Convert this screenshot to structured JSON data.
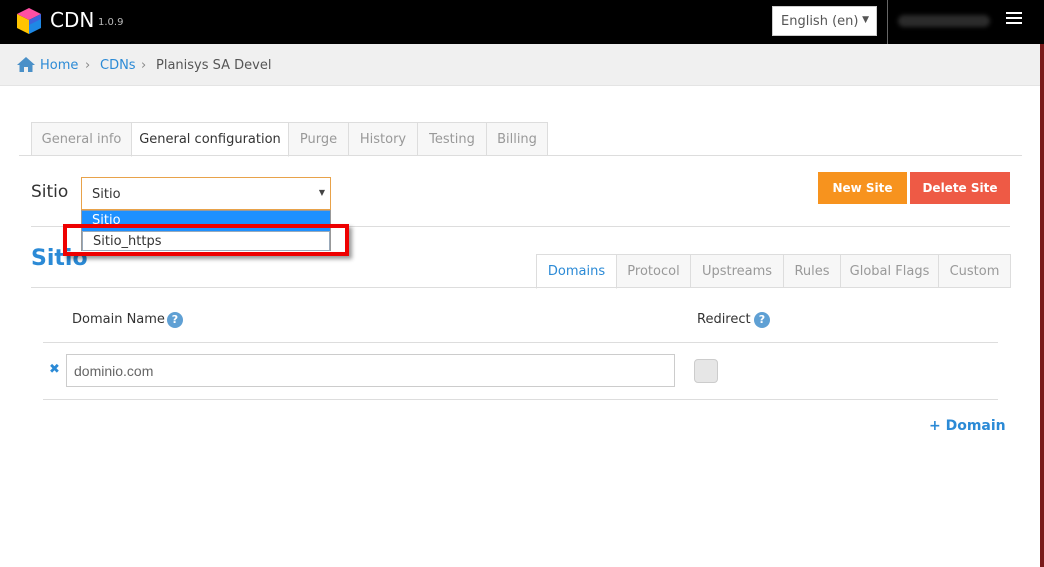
{
  "header": {
    "brand": "CDN",
    "version": "1.0.9",
    "language": "English (en)",
    "menu_icon": "hamburger-icon",
    "logo_colors": [
      "#e91e8c",
      "#ffd400",
      "#2196f3",
      "#4caf50"
    ]
  },
  "breadcrumb": {
    "home": "Home",
    "cdns": "CDNs",
    "current": "Planisys SA Devel",
    "separator": "›"
  },
  "tabs": [
    {
      "label": "General info"
    },
    {
      "label": "General configuration"
    },
    {
      "label": "Purge"
    },
    {
      "label": "History"
    },
    {
      "label": "Testing"
    },
    {
      "label": "Billing"
    }
  ],
  "site": {
    "label": "Sitio",
    "selected": "Sitio",
    "options": [
      "Sitio",
      "Sitio_https"
    ],
    "title": "Sitio"
  },
  "buttons": {
    "new_site": "New Site",
    "delete_site": "Delete Site"
  },
  "subtabs": [
    {
      "label": "Domains"
    },
    {
      "label": "Protocol"
    },
    {
      "label": "Upstreams"
    },
    {
      "label": "Rules"
    },
    {
      "label": "Global Flags"
    },
    {
      "label": "Custom"
    }
  ],
  "domains": {
    "col_domain": "Domain Name",
    "col_redirect": "Redirect",
    "help_glyph": "?",
    "remove_glyph": "✖",
    "rows": [
      {
        "value": "dominio.com",
        "redirect": false
      }
    ],
    "add_label": "+ Domain"
  },
  "colors": {
    "accent": "#2b8ad6",
    "new_site": "#f7931e",
    "delete_site": "#ee5a45",
    "highlight_annotation": "#e00000"
  }
}
